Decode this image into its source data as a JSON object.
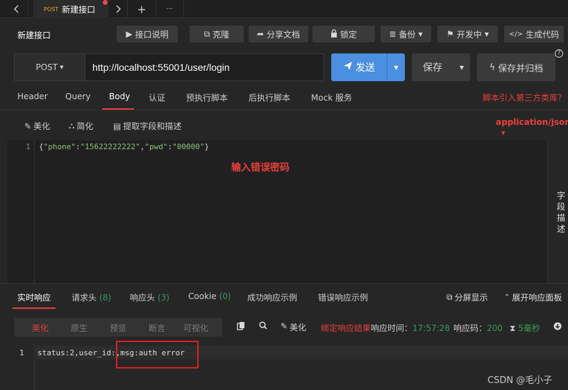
{
  "tabbar": {
    "back_icon": "chevron-left-icon",
    "forward_icon": "chevron-right-icon",
    "active_tab": {
      "method": "POST",
      "name": "新建接口"
    },
    "new_tab": "+",
    "more": "···"
  },
  "header": {
    "title": "新建接口",
    "buttons": {
      "doc": "接口说明",
      "clone": "克隆",
      "share": "分享文档",
      "lock": "锁定",
      "backup": "备份",
      "status": "开发中",
      "code": "生成代码"
    }
  },
  "request": {
    "method": "POST",
    "url": "http://localhost:55001/user/login",
    "send": "发送",
    "save": "保存",
    "save_archive": "保存并归档",
    "help": "?"
  },
  "req_tabs": [
    "Header",
    "Query",
    "Body",
    "认证",
    "预执行脚本",
    "后执行脚本",
    "Mock 服务"
  ],
  "active_req_tab": "Body",
  "script_link": "脚本引入第三方类库？",
  "body_toolbar": {
    "beautify": "美化",
    "simplify": "简化",
    "extract": "提取字段和描述",
    "content_type": "application/json"
  },
  "editor": {
    "line_number": "1",
    "code_parts": [
      "{",
      "\"phone\"",
      ":",
      "\"15622222222\"",
      ",",
      "\"pwd\"",
      ":",
      "\"00000\"",
      "}"
    ],
    "annotation": "输入错误密码",
    "side_panel": "字段描述"
  },
  "resp_tabs": [
    {
      "label": "实时响应",
      "count": ""
    },
    {
      "label": "请求头",
      "count": "(8)"
    },
    {
      "label": "响应头",
      "count": "(3)"
    },
    {
      "label": "Cookie",
      "count": "(0)"
    },
    {
      "label": "成功响应示例",
      "count": ""
    },
    {
      "label": "错误响应示例",
      "count": ""
    }
  ],
  "resp_right": {
    "split": "分屏显示",
    "expand": "展开响应面板"
  },
  "view_modes": [
    "美化",
    "原生",
    "预览",
    "断言",
    "可视化"
  ],
  "active_view_mode": "美化",
  "resp_toolbar": {
    "beautify": "美化",
    "bind_label": "绑定响应结果",
    "time_label": "响应时间：",
    "time_value": "17:57:28",
    "code_label": "响应码：",
    "code_value": "200",
    "duration_value": "5毫秒"
  },
  "response": {
    "line_number": "1",
    "text": "status:2,user_id:,msg:auth error"
  },
  "watermark": "CSDN @毛小子",
  "colors": {
    "accent_red": "#e8403b",
    "send_blue": "#4a8fe0",
    "success_green": "#3a9a5c",
    "method_orange": "#f0a030"
  }
}
